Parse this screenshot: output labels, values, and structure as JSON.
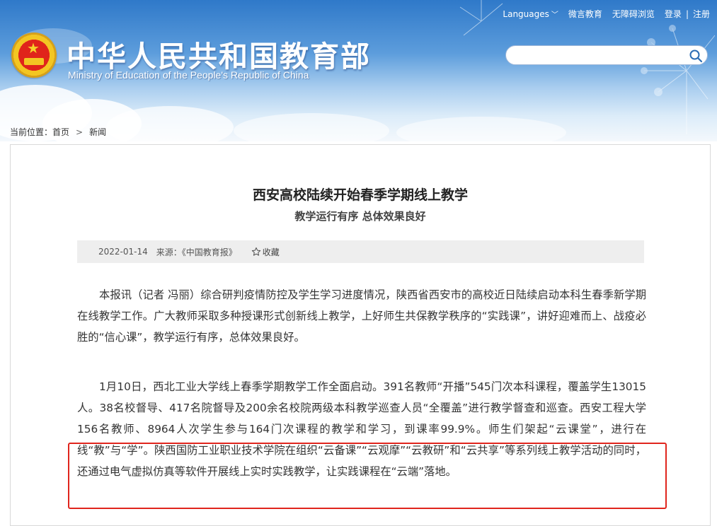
{
  "header": {
    "site_title": "中华人民共和国教育部",
    "site_subtitle": "Ministry of Education of the People's Republic of China",
    "nav": {
      "languages": "Languages",
      "weishang": "微言教育",
      "accessibility": "无障碍浏览",
      "login": "登录",
      "separator": "|",
      "register": "注册"
    },
    "search": {
      "value": "",
      "placeholder": ""
    },
    "icons": {
      "emblem": "national-emblem-icon",
      "search": "search-icon",
      "chevron": "chevron-down-icon"
    }
  },
  "breadcrumb": {
    "label": "当前位置：",
    "home": "首页",
    "arrow": ">",
    "current": "新闻"
  },
  "article": {
    "title": "西安高校陆续开始春季学期线上教学",
    "subtitle": "教学运行有序 总体效果良好",
    "meta": {
      "date": "2022-01-14",
      "source": "来源：《中国教育报》",
      "favorite": "收藏"
    },
    "paragraphs": [
      "本报讯（记者 冯丽）综合研判疫情防控及学生学习进度情况，陕西省西安市的高校近日陆续启动本科生春季新学期在线教学工作。广大教师采取多种授课形式创新线上教学，上好师生共保教学秩序的“实践课”，讲好迎难而上、战疫必胜的“信心课”，教学运行有序，总体效果良好。",
      "1月10日，西北工业大学线上春季学期教学工作全面启动。391名教师“开播”545门次本科课程，覆盖学生13015人。38名校督导、417名院督导及200余名校院两级本科教学巡查人员“全覆盖”进行教学督查和巡查。西安工程大学156名教师、8964人次学生参与164门次课程的教学和学习，到课率99.9%。师生们架起“云课堂”，进行在线“教”与“学”。陕西国防工业职业技术学院在组织“云备课”“云观摩”“云教研”和“云共享”等系列线上教学活动的同时，还通过电气虚拟仿真等软件开展线上实时实践教学，让实践课程在“云端”落地。"
    ]
  },
  "colors": {
    "highlight_border": "#e0251d",
    "meta_bar": "#eeeeee",
    "text": "#333333",
    "sky_top": "#2f79c9"
  }
}
